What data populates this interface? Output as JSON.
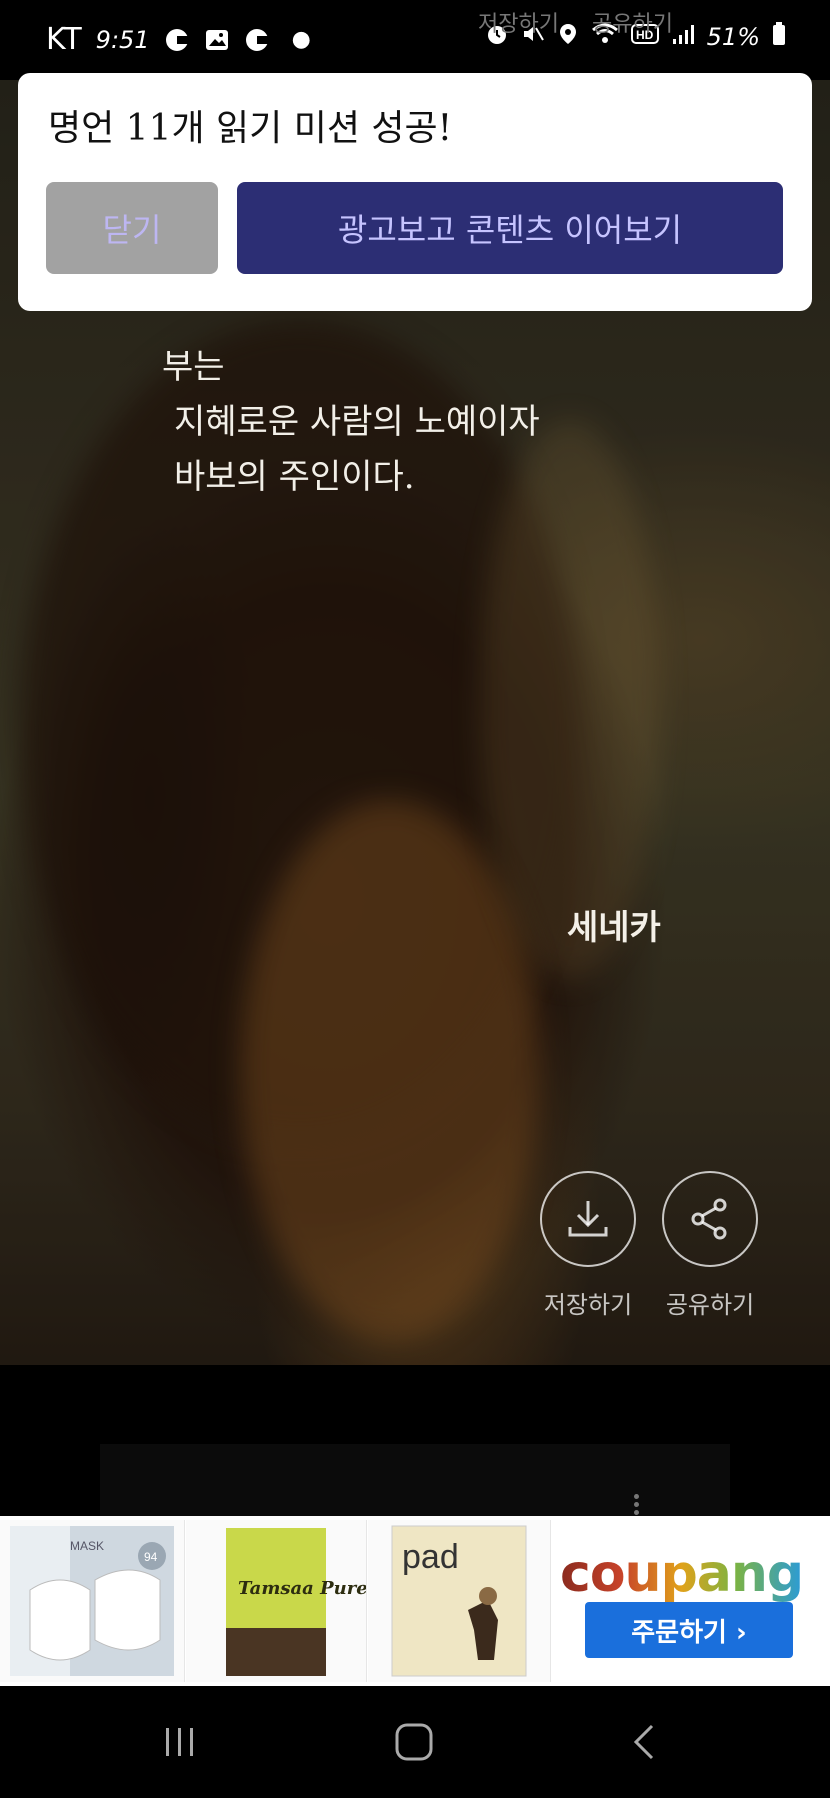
{
  "status_bar": {
    "carrier": "KT",
    "time": "9:51",
    "battery": "51%"
  },
  "ghost_header": {
    "save_label": "저장하기",
    "share_label": "공유하기"
  },
  "dialog": {
    "title": "명언 11개 읽기 미션 성공!",
    "close_label": "닫기",
    "continue_label": "광고보고 콘텐츠 이어보기"
  },
  "quote": {
    "line1": "부는",
    "line2": "지혜로운 사람의 노예이자",
    "line3": "바보의 주인이다.",
    "author": "세네카"
  },
  "actions": {
    "save_label": "저장하기",
    "share_label": "공유하기"
  },
  "ad": {
    "products": [
      {
        "label": "MASK",
        "badge": "94"
      },
      {
        "label": "Tamsaa Pure"
      },
      {
        "label": "pad"
      }
    ],
    "brand": "coupang",
    "order_label": "주문하기 ›"
  }
}
